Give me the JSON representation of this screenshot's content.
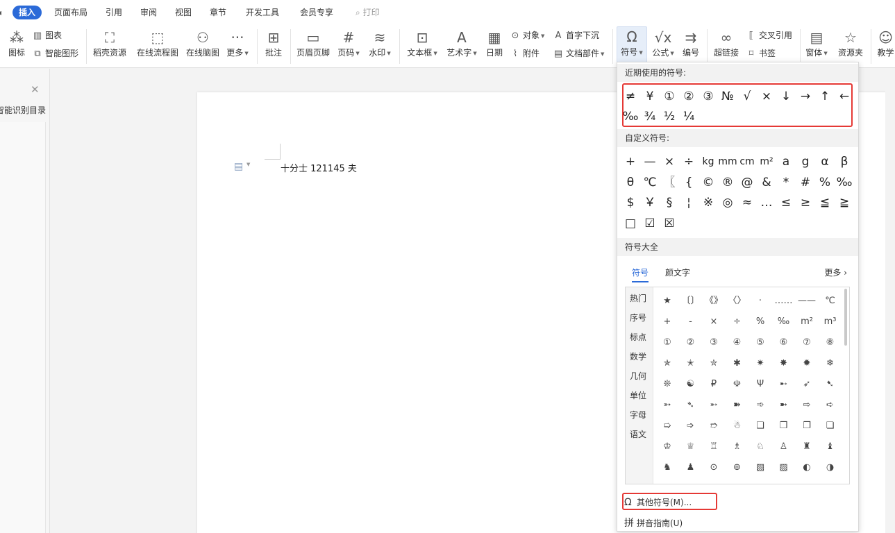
{
  "menu": {
    "tabs": [
      "插入",
      "页面布局",
      "引用",
      "审阅",
      "视图",
      "章节",
      "开发工具",
      "会员专享"
    ],
    "print": "打印"
  },
  "ribbon": {
    "icons_label": "图标",
    "chart_label": "图表",
    "smart_graphic_label": "智能图形",
    "docer_label": "稻壳资源",
    "flowchart_label": "在线流程图",
    "mindmap_label": "在线脑图",
    "more_label": "更多",
    "comment_label": "批注",
    "header_footer_label": "页眉页脚",
    "page_number_label": "页码",
    "watermark_label": "水印",
    "textbox_label": "文本框",
    "wordart_label": "艺术字",
    "date_label": "日期",
    "object_label": "对象",
    "attachment_label": "附件",
    "dropcap_label": "首字下沉",
    "doc_parts_label": "文档部件",
    "symbol_label": "符号",
    "formula_label": "公式",
    "numbering_label": "编号",
    "hyperlink_label": "超链接",
    "cross_ref_label": "交叉引用",
    "bookmark_label": "书签",
    "window_label": "窗体",
    "resource_folder_label": "资源夹",
    "teaching_label": "教学"
  },
  "left_panel": {
    "title": "智能识别目录"
  },
  "document": {
    "text": "十分士 121145 夫"
  },
  "dropdown": {
    "recent_title": "近期使用的符号:",
    "recent_symbols": [
      "≠",
      "¥",
      "①",
      "②",
      "③",
      "№",
      "√",
      "×",
      "↓",
      "→",
      "↑",
      "←",
      "‰",
      "¾",
      "½",
      "¼"
    ],
    "custom_title": "自定义符号:",
    "custom_symbols": [
      "+",
      "—",
      "×",
      "÷",
      "kg",
      "mm",
      "cm",
      "m²",
      "a",
      "g",
      "α",
      "β",
      "θ",
      "℃",
      "〖",
      "{",
      "©",
      "®",
      "@",
      "&",
      "*",
      "#",
      "%",
      "‰",
      "$",
      "￥",
      "§",
      "¦",
      "※",
      "◎",
      "≈",
      "…",
      "≤",
      "≥",
      "≦",
      "≧",
      "□",
      "☑",
      "☒"
    ],
    "library_title": "符号大全",
    "tab_symbols": "符号",
    "tab_kaomoji": "颜文字",
    "tab_more": "更多",
    "categories": [
      "热门",
      "序号",
      "标点",
      "数学",
      "几何",
      "单位",
      "字母",
      "语文"
    ],
    "grid_symbols": [
      "★",
      "〔〕",
      "《》",
      "〈〉",
      "·",
      "……",
      "——",
      "℃",
      "+",
      "-",
      "×",
      "÷",
      "%",
      "‰",
      "m²",
      "m³",
      "①",
      "②",
      "③",
      "④",
      "⑤",
      "⑥",
      "⑦",
      "⑧",
      "✯",
      "✭",
      "✮",
      "✱",
      "✷",
      "✸",
      "✹",
      "❄",
      "❊",
      "☯",
      "₽",
      "☫",
      "Ψ",
      "➸",
      "➶",
      "➷",
      "➳",
      "➴",
      "➵",
      "➽",
      "➾",
      "➼",
      "⇨",
      "➪",
      "➯",
      "➩",
      "➱",
      "☃",
      "❑",
      "❒",
      "❐",
      "❏",
      "♔",
      "♕",
      "♖",
      "♗",
      "♘",
      "♙",
      "♜",
      "♝",
      "♞",
      "♟",
      "⊙",
      "⊚",
      "▧",
      "▨",
      "◐",
      "◑"
    ],
    "other_symbols": "其他符号(M)...",
    "pinyin_guide": "拼音指南(U)"
  }
}
